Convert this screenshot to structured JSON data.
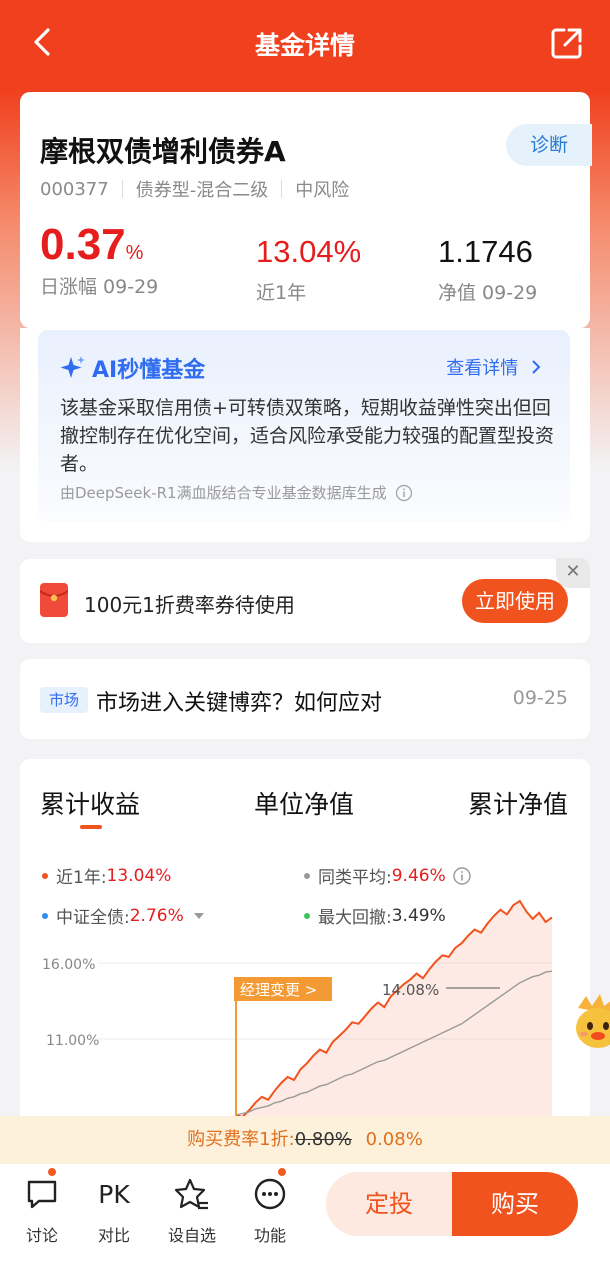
{
  "nav": {
    "title": "基金详情"
  },
  "fund": {
    "name": "摩根双债增利债券A",
    "code": "000377",
    "type": "债券型-混合二级",
    "risk": "中风险",
    "diagnose_label": "诊断",
    "daily_change_value": "0.37",
    "daily_change_unit": "%",
    "daily_change_label": "日涨幅 09-29",
    "one_year_value": "13.04%",
    "one_year_label": "近1年",
    "nav_value": "1.1746",
    "nav_label": "净值 09-29"
  },
  "ai": {
    "title": "AI秒懂基金",
    "link_label": "查看详情",
    "text": "该基金采取信用债+可转债双策略，短期收益弹性突出但回撤控制存在优化空间，适合风险承受能力较强的配置型投资者。",
    "footnote": "由DeepSeek-R1满血版结合专业基金数据库生成"
  },
  "coupon": {
    "text": "100元1折费率券待使用",
    "button_label": "立即使用",
    "close_symbol": "✕"
  },
  "news": {
    "tag": "市场",
    "title": "市场进入关键博弈？如何应对",
    "date": "09-25"
  },
  "chart_tabs": [
    "累计收益",
    "单位净值",
    "累计净值"
  ],
  "legend": [
    {
      "label": "近1年:",
      "value": "13.04%",
      "color": "#f0531e"
    },
    {
      "label": "同类平均:",
      "value": "9.46%",
      "color": "#999999"
    },
    {
      "label": "中证全债:",
      "value": "2.76%",
      "color": "#2f8cf0"
    },
    {
      "label": "最大回撤:",
      "value": "3.49%",
      "color": "#3cc45a"
    }
  ],
  "chart_data": {
    "type": "line",
    "yticks": [
      "16.00%",
      "11.00%"
    ],
    "ylim": [
      6,
      16
    ],
    "manager_change_label": "经理变更 >",
    "max_label": "14.08%",
    "series": [
      {
        "name": "近1年",
        "color": "#f0531e",
        "values": [
          0.0,
          -0.2,
          0.3,
          0.8,
          1.2,
          1.0,
          1.6,
          2.1,
          2.5,
          2.3,
          3.0,
          3.4,
          3.9,
          4.3,
          4.1,
          4.8,
          5.2,
          5.6,
          6.1,
          6.0,
          6.5,
          7.0,
          7.4,
          7.1,
          7.8,
          8.2,
          8.6,
          8.9,
          9.3,
          9.0,
          9.6,
          10.1,
          10.5,
          10.4,
          11.0,
          11.3,
          11.8,
          12.2,
          12.0,
          12.6,
          13.1,
          13.5,
          13.2,
          13.8,
          14.08,
          13.4,
          12.9,
          13.3,
          12.7,
          13.0
        ]
      },
      {
        "name": "同类平均",
        "color": "#999999",
        "values": [
          0.0,
          0.1,
          0.2,
          0.4,
          0.5,
          0.6,
          0.8,
          0.9,
          1.1,
          1.2,
          1.4,
          1.5,
          1.7,
          1.9,
          2.0,
          2.2,
          2.4,
          2.6,
          2.7,
          2.9,
          3.1,
          3.3,
          3.5,
          3.6,
          3.8,
          4.0,
          4.2,
          4.4,
          4.6,
          4.8,
          5.0,
          5.2,
          5.4,
          5.6,
          5.8,
          6.0,
          6.3,
          6.6,
          6.9,
          7.2,
          7.5,
          7.8,
          8.1,
          8.4,
          8.7,
          8.9,
          9.1,
          9.2,
          9.4,
          9.46
        ]
      }
    ]
  },
  "fee_bar": {
    "prefix": "购买费率1折:",
    "original": "0.80%",
    "discounted": "0.08%"
  },
  "bottom": {
    "items": [
      {
        "label": "讨论",
        "icon": "discussion-icon"
      },
      {
        "label": "对比",
        "icon": "pk-icon",
        "glyph": "PK"
      },
      {
        "label": "设自选",
        "icon": "star-add-icon"
      },
      {
        "label": "功能",
        "icon": "more-icon"
      }
    ],
    "dingtou_label": "定投",
    "buy_label": "购买"
  }
}
